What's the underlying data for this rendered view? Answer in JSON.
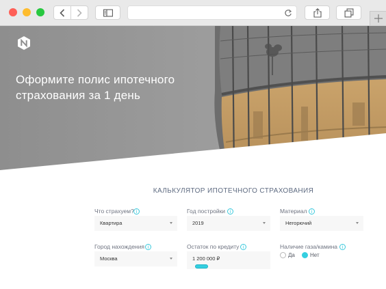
{
  "hero": {
    "title_line1": "Оформите полис ипотечного",
    "title_line2": "страхования за 1 день"
  },
  "calculator": {
    "title": "КАЛЬКУЛЯТОР ИПОТЕЧНОГО СТРАХОВАНИЯ",
    "fields": {
      "what_insure": {
        "label": "Что страхуем?",
        "value": "Квартира"
      },
      "year_built": {
        "label": "Год постройки",
        "value": "2019"
      },
      "material": {
        "label": "Материал",
        "value": "Негорючий"
      },
      "city": {
        "label": "Город нахождения",
        "value": "Москва"
      },
      "loan_balance": {
        "label": "Остаток по кредиту",
        "value": "1 200 000 ₽"
      },
      "gas": {
        "label": "Наличие газа/камина",
        "options": [
          "Да",
          "Нет"
        ],
        "selected": "Нет"
      }
    }
  },
  "colors": {
    "accent": "#35cfe0",
    "title_text": "#5d6a80",
    "hero_overlay": "#9a9a9a",
    "building_warm": "#c9a46a"
  },
  "icons": {
    "info": "i",
    "browser": [
      "back-icon",
      "forward-icon",
      "sidebar-icon",
      "reload-icon",
      "share-icon",
      "tabs-icon",
      "plus-icon"
    ]
  }
}
